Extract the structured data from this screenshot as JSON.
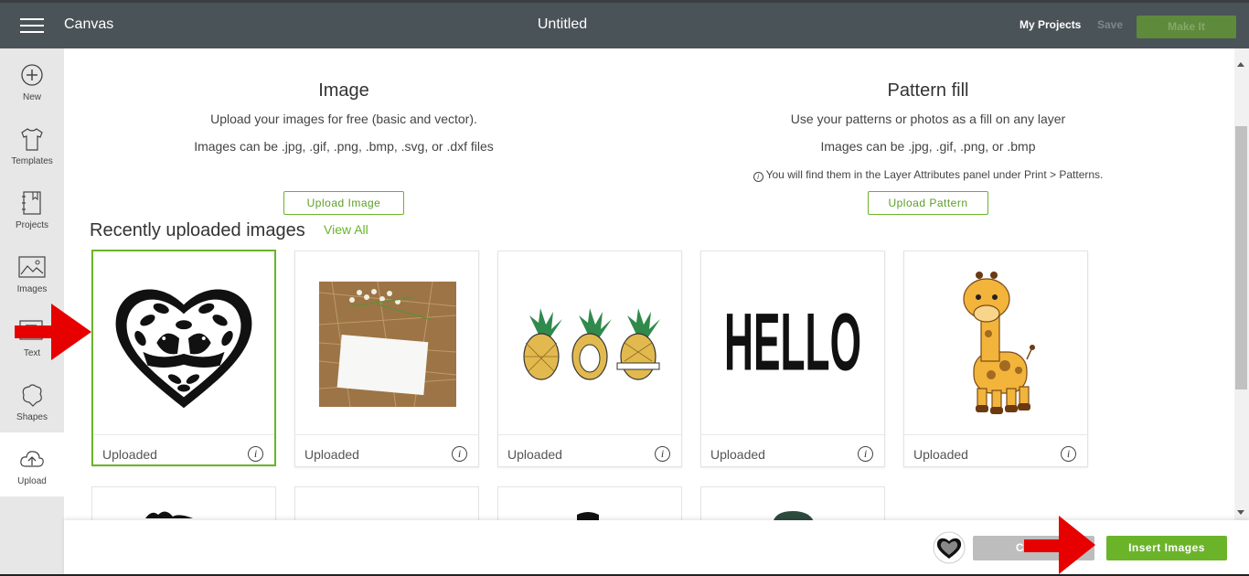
{
  "header": {
    "app_name": "Canvas",
    "doc_title": "Untitled",
    "my_projects": "My Projects",
    "save": "Save",
    "make_it": "Make It"
  },
  "sidebar": {
    "items": [
      {
        "label": "New",
        "icon": "plus-circle-icon"
      },
      {
        "label": "Templates",
        "icon": "shirt-icon"
      },
      {
        "label": "Projects",
        "icon": "notebook-icon"
      },
      {
        "label": "Images",
        "icon": "image-icon"
      },
      {
        "label": "Text",
        "icon": "text-icon"
      },
      {
        "label": "Shapes",
        "icon": "shapes-icon"
      },
      {
        "label": "Upload",
        "icon": "cloud-upload-icon"
      }
    ]
  },
  "image_section": {
    "title": "Image",
    "line1": "Upload your images for free (basic and vector).",
    "line2": "Images can be .jpg, .gif, .png, .bmp, .svg, or .dxf files",
    "button": "Upload Image"
  },
  "pattern_section": {
    "title": "Pattern fill",
    "line1": "Use your patterns or photos as a fill on any layer",
    "line2": "Images can be .jpg, .gif, .png, or .bmp",
    "note": "You will find them in the Layer Attributes panel under Print > Patterns.",
    "button": "Upload Pattern"
  },
  "recent": {
    "title": "Recently uploaded images",
    "view_all": "View All",
    "cards": [
      {
        "label": "Uploaded",
        "content": "heart-birds-image",
        "selected": true
      },
      {
        "label": "Uploaded",
        "content": "photo-card-on-straw-image",
        "selected": false
      },
      {
        "label": "Uploaded",
        "content": "pineapples-image",
        "selected": false
      },
      {
        "label": "Uploaded",
        "content": "hello-text-image",
        "text": "HELLO",
        "selected": false
      },
      {
        "label": "Uploaded",
        "content": "giraffe-image",
        "selected": false
      }
    ]
  },
  "footer": {
    "cancel": "Cancel",
    "insert": "Insert Images"
  },
  "colors": {
    "accent": "#6bb42a",
    "topbar": "#4a5358",
    "annotation_arrow": "#e60000"
  }
}
